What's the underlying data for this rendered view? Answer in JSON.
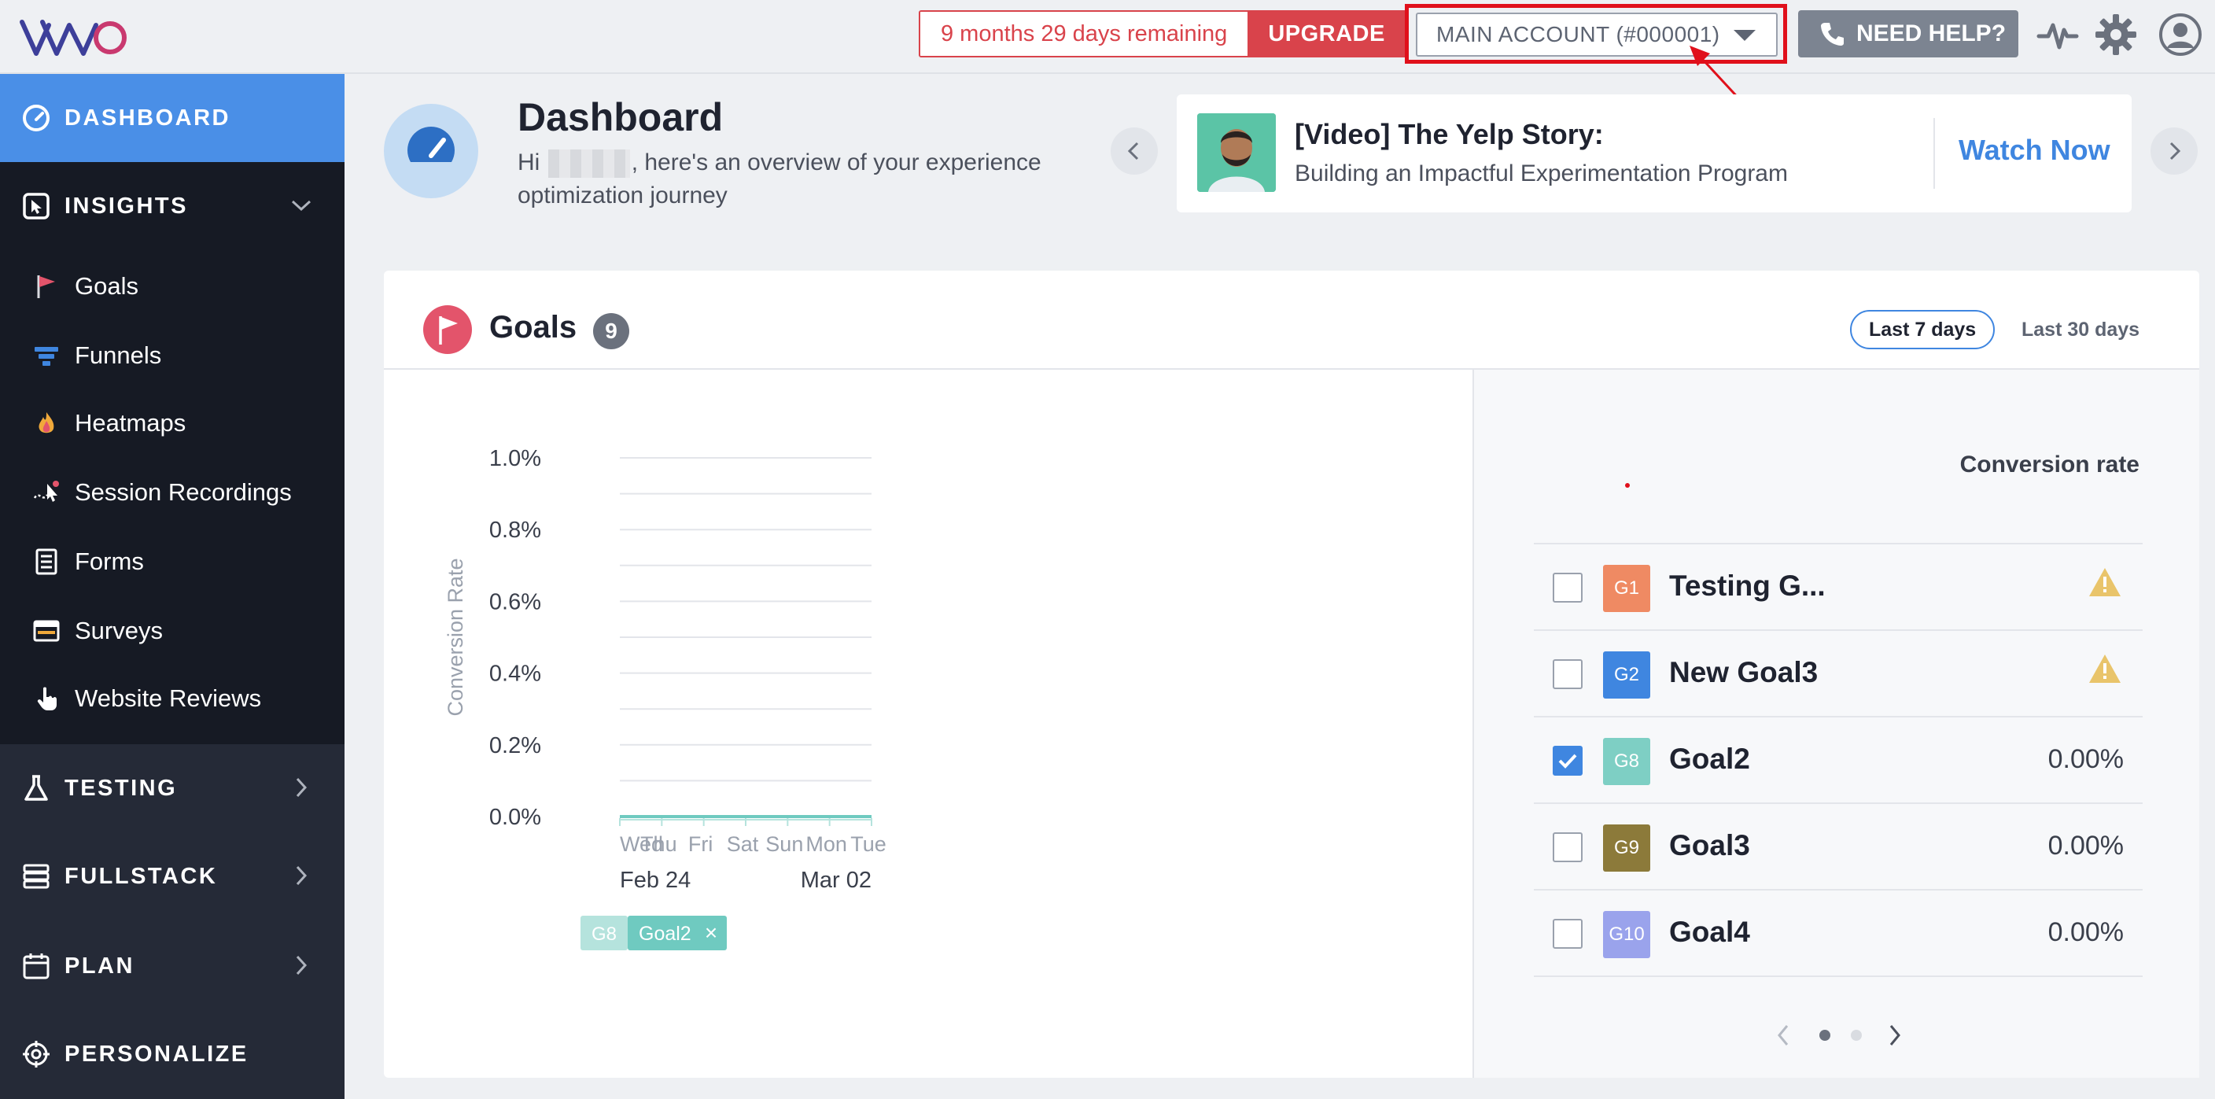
{
  "topbar": {
    "trial_text": "9 months 29 days remaining",
    "upgrade_label": "UPGRADE",
    "account_label": "MAIN ACCOUNT (#000001)",
    "help_label": "NEED HELP?"
  },
  "sidebar": {
    "dashboard": "DASHBOARD",
    "insights": "INSIGHTS",
    "insight_items": [
      "Goals",
      "Funnels",
      "Heatmaps",
      "Session Recordings",
      "Forms",
      "Surveys",
      "Website Reviews"
    ],
    "testing": "TESTING",
    "fullstack": "FULLSTACK",
    "plan": "PLAN",
    "personalize": "PERSONALIZE"
  },
  "header": {
    "title": "Dashboard",
    "greeting_prefix": "Hi",
    "greeting_suffix": ", here's an overview of your experience optimization journey"
  },
  "promo": {
    "title": "[Video] The Yelp Story:",
    "subtitle": "Building an Impactful Experimentation Program",
    "cta": "Watch Now"
  },
  "goals": {
    "title": "Goals",
    "count": "9",
    "range_active": "Last 7 days",
    "range_other": "Last 30 days",
    "column_header": "Conversion rate",
    "rows": [
      {
        "badge": "G1",
        "color": "#ef8a63",
        "name": "Testing G...",
        "rate": "",
        "warning": true,
        "checked": false
      },
      {
        "badge": "G2",
        "color": "#3f86e0",
        "name": "New Goal3",
        "rate": "",
        "warning": true,
        "checked": false
      },
      {
        "badge": "G8",
        "color": "#7ecfc4",
        "name": "Goal2",
        "rate": "0.00%",
        "warning": false,
        "checked": true
      },
      {
        "badge": "G9",
        "color": "#8c7a3a",
        "name": "Goal3",
        "rate": "0.00%",
        "warning": false,
        "checked": false
      },
      {
        "badge": "G10",
        "color": "#9aa3ec",
        "name": "Goal4",
        "rate": "0.00%",
        "warning": false,
        "checked": false
      }
    ]
  },
  "chart_data": {
    "type": "line",
    "ylabel": "Conversion Rate",
    "ylim": [
      0,
      1.0
    ],
    "y_ticks": [
      "1.0%",
      "0.8%",
      "0.6%",
      "0.4%",
      "0.2%",
      "0.0%"
    ],
    "categories": [
      "Wed",
      "Thu",
      "Fri",
      "Sat",
      "Sun",
      "Mon",
      "Tue"
    ],
    "date_labels": [
      "Feb 24",
      "Mar 02"
    ],
    "series": [
      {
        "name": "Goal2",
        "badge": "G8",
        "color": "#6fcac0",
        "values": [
          0,
          0,
          0,
          0,
          0,
          0,
          0
        ]
      }
    ],
    "grid": true
  }
}
